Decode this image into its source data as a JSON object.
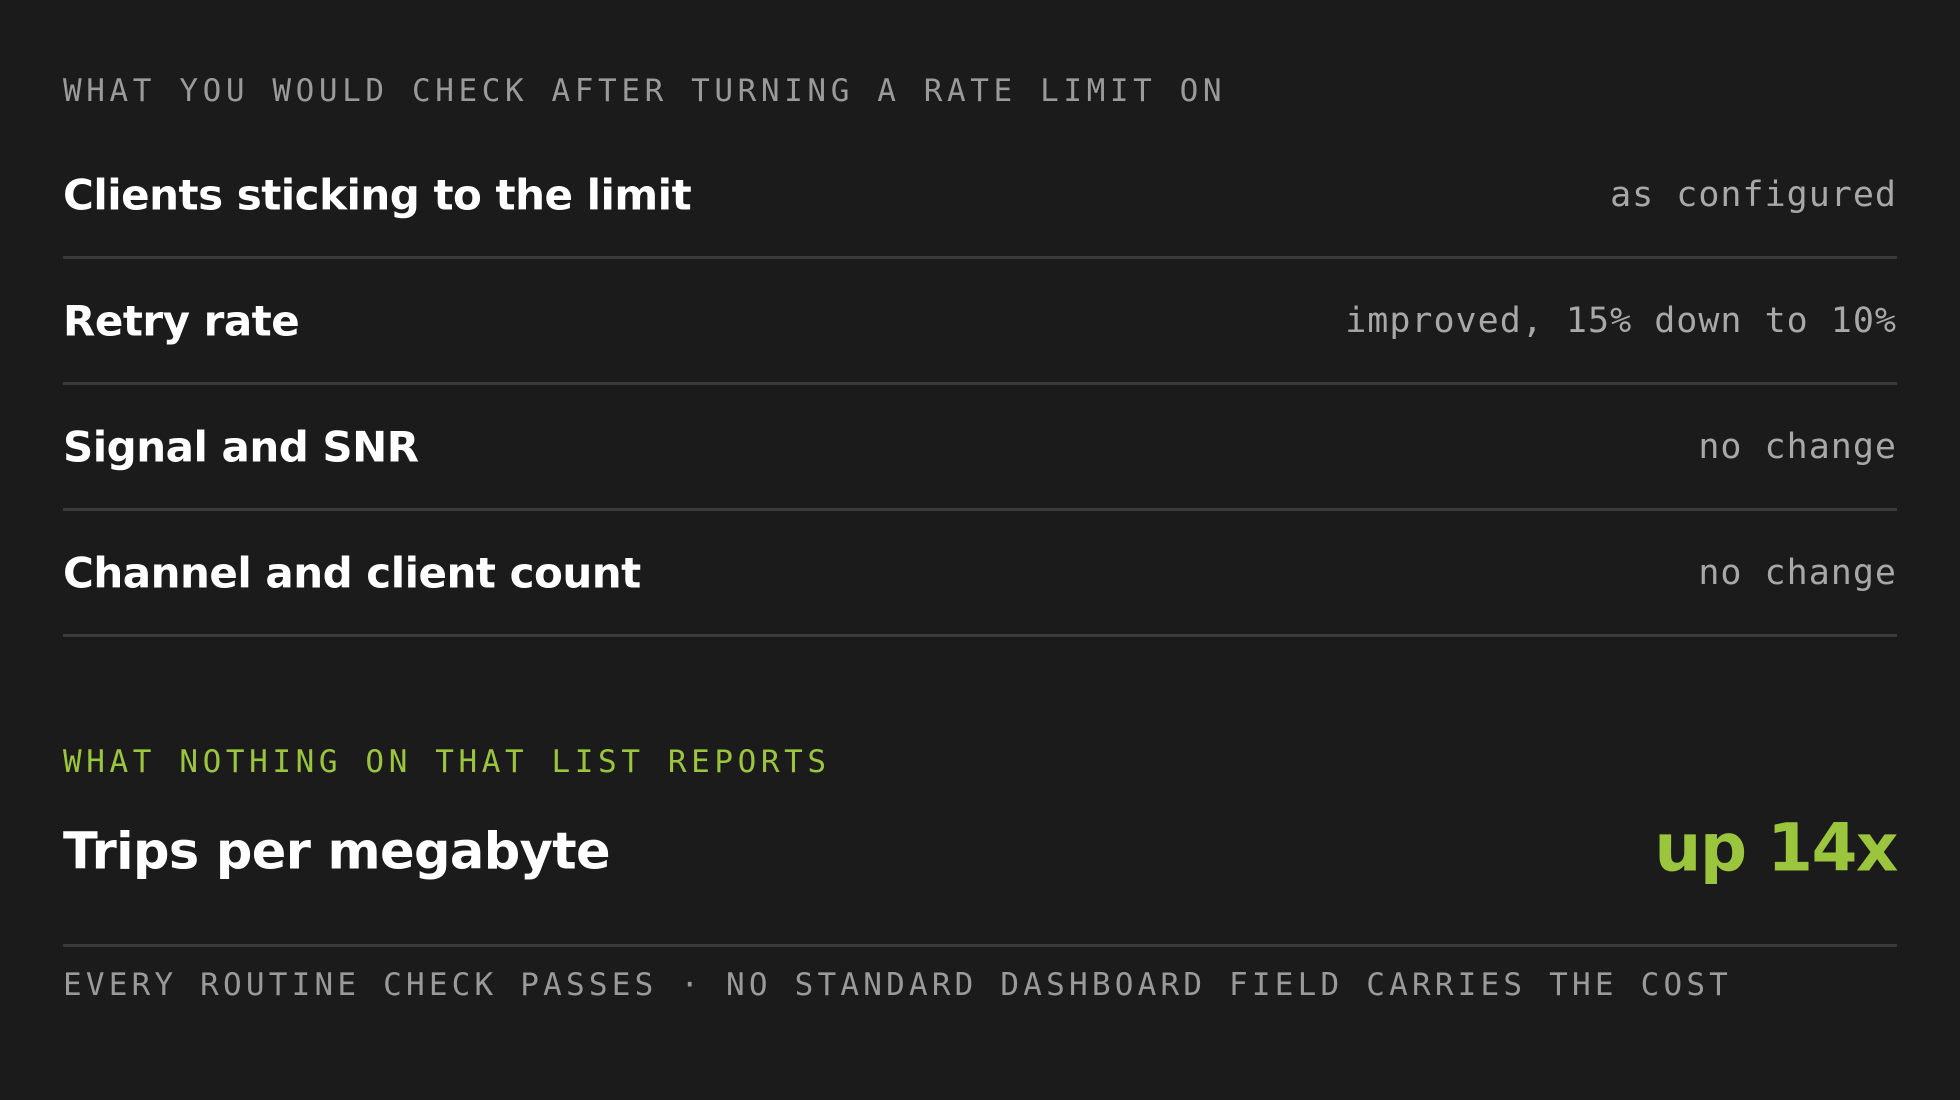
{
  "section_header": "WHAT YOU WOULD CHECK AFTER TURNING A RATE LIMIT ON",
  "checks": [
    {
      "label": "Clients sticking to the limit",
      "value": "as configured"
    },
    {
      "label": "Retry rate",
      "value": "improved, 15% down to 10%"
    },
    {
      "label": "Signal and SNR",
      "value": "no change"
    },
    {
      "label": "Channel and client count",
      "value": "no change"
    }
  ],
  "highlight": {
    "header": "WHAT NOTHING ON THAT LIST REPORTS",
    "label": "Trips per megabyte",
    "value": "up 14x"
  },
  "footer": "EVERY ROUTINE CHECK PASSES · NO STANDARD DASHBOARD FIELD CARRIES THE COST",
  "colors": {
    "background": "#1b1b1b",
    "accent": "#9bc53d",
    "muted_text": "#9a9a9a",
    "divider": "#3a3a3a"
  }
}
